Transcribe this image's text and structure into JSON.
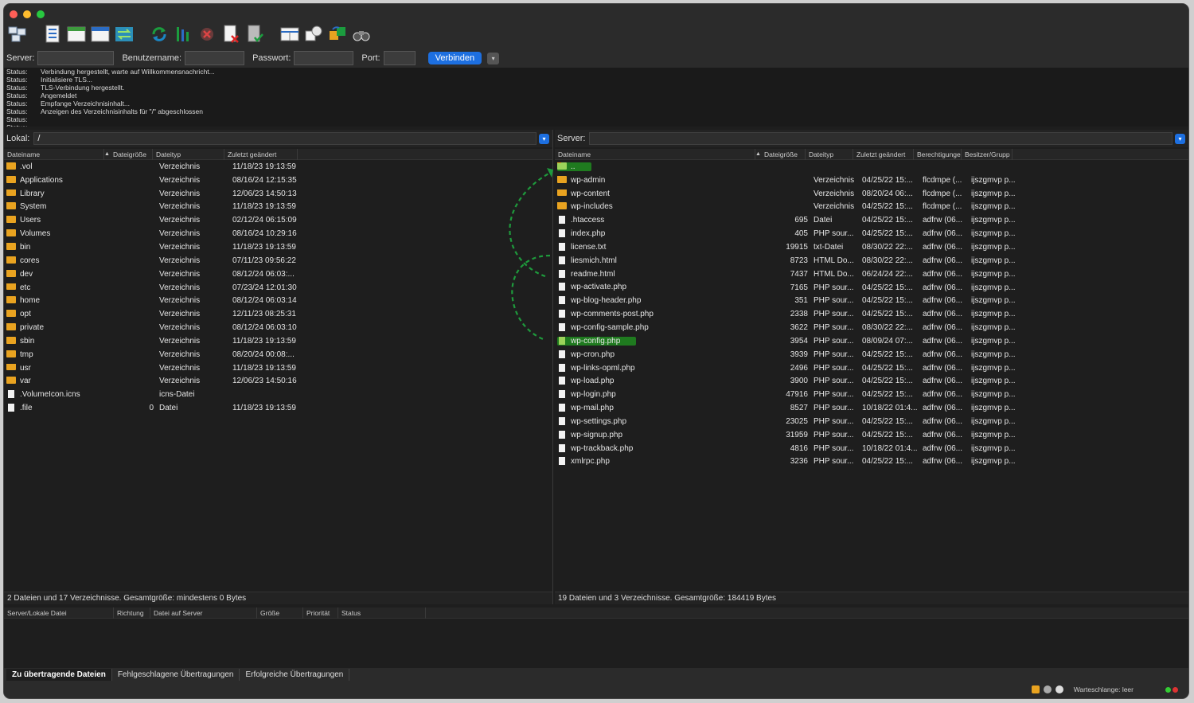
{
  "quickconnect": {
    "server_label": "Server:",
    "user_label": "Benutzername:",
    "password_label": "Passwort:",
    "port_label": "Port:",
    "connect_label": "Verbinden"
  },
  "log": [
    {
      "label": "Status:",
      "text": "Verbindung hergestellt, warte auf Willkommensnachricht..."
    },
    {
      "label": "Status:",
      "text": "Initialisiere TLS..."
    },
    {
      "label": "Status:",
      "text": "TLS-Verbindung hergestellt."
    },
    {
      "label": "Status:",
      "text": "Angemeldet"
    },
    {
      "label": "Status:",
      "text": "Empfange Verzeichnisinhalt..."
    },
    {
      "label": "Status:",
      "text": "Anzeigen des Verzeichnisinhalts für \"/\" abgeschlossen"
    },
    {
      "label": "Status:",
      "text": ""
    },
    {
      "label": "Status:",
      "text": ""
    }
  ],
  "local": {
    "path_label": "Lokal:",
    "path": "/",
    "columns": [
      "Dateiname",
      "Dateigröße",
      "Dateityp",
      "Zuletzt geändert"
    ],
    "rows": [
      {
        "name": ".vol",
        "kind": "folder",
        "size": "",
        "type": "Verzeichnis",
        "modified": "11/18/23 19:13:59"
      },
      {
        "name": "Applications",
        "kind": "folder",
        "size": "",
        "type": "Verzeichnis",
        "modified": "08/16/24 12:15:35"
      },
      {
        "name": "Library",
        "kind": "folder",
        "size": "",
        "type": "Verzeichnis",
        "modified": "12/06/23 14:50:13"
      },
      {
        "name": "System",
        "kind": "folder",
        "size": "",
        "type": "Verzeichnis",
        "modified": "11/18/23 19:13:59"
      },
      {
        "name": "Users",
        "kind": "folder",
        "size": "",
        "type": "Verzeichnis",
        "modified": "02/12/24 06:15:09"
      },
      {
        "name": "Volumes",
        "kind": "folder",
        "size": "",
        "type": "Verzeichnis",
        "modified": "08/16/24 10:29:16"
      },
      {
        "name": "bin",
        "kind": "folder",
        "size": "",
        "type": "Verzeichnis",
        "modified": "11/18/23 19:13:59"
      },
      {
        "name": "cores",
        "kind": "folder",
        "size": "",
        "type": "Verzeichnis",
        "modified": "07/11/23 09:56:22"
      },
      {
        "name": "dev",
        "kind": "folder",
        "size": "",
        "type": "Verzeichnis",
        "modified": "08/12/24 06:03:..."
      },
      {
        "name": "etc",
        "kind": "folder",
        "size": "",
        "type": "Verzeichnis",
        "modified": "07/23/24 12:01:30"
      },
      {
        "name": "home",
        "kind": "folder",
        "size": "",
        "type": "Verzeichnis",
        "modified": "08/12/24 06:03:14"
      },
      {
        "name": "opt",
        "kind": "folder",
        "size": "",
        "type": "Verzeichnis",
        "modified": "12/11/23 08:25:31"
      },
      {
        "name": "private",
        "kind": "folder",
        "size": "",
        "type": "Verzeichnis",
        "modified": "08/12/24 06:03:10"
      },
      {
        "name": "sbin",
        "kind": "folder",
        "size": "",
        "type": "Verzeichnis",
        "modified": "11/18/23 19:13:59"
      },
      {
        "name": "tmp",
        "kind": "folder",
        "size": "",
        "type": "Verzeichnis",
        "modified": "08/20/24 00:08:..."
      },
      {
        "name": "usr",
        "kind": "folder",
        "size": "",
        "type": "Verzeichnis",
        "modified": "11/18/23 19:13:59"
      },
      {
        "name": "var",
        "kind": "folder",
        "size": "",
        "type": "Verzeichnis",
        "modified": "12/06/23 14:50:16"
      },
      {
        "name": ".VolumeIcon.icns",
        "kind": "file",
        "size": "",
        "type": "icns-Datei",
        "modified": ""
      },
      {
        "name": ".file",
        "kind": "file",
        "size": "0",
        "type": "Datei",
        "modified": "11/18/23 19:13:59"
      }
    ],
    "status": "2 Dateien und 17 Verzeichnisse. Gesamtgröße: mindestens 0 Bytes"
  },
  "remote": {
    "path_label": "Server:",
    "path": "",
    "columns": [
      "Dateiname",
      "Dateigröße",
      "Dateityp",
      "Zuletzt geändert",
      "Berechtigunge",
      "Besitzer/Grupp"
    ],
    "rows": [
      {
        "name": "..",
        "kind": "folder",
        "size": "",
        "type": "",
        "modified": "",
        "perm": "",
        "owner": "",
        "highlight": true
      },
      {
        "name": "wp-admin",
        "kind": "folder",
        "size": "",
        "type": "Verzeichnis",
        "modified": "04/25/22 15:...",
        "perm": "flcdmpe (...",
        "owner": "ijszgmvp p..."
      },
      {
        "name": "wp-content",
        "kind": "folder",
        "size": "",
        "type": "Verzeichnis",
        "modified": "08/20/24 06:...",
        "perm": "flcdmpe (...",
        "owner": "ijszgmvp p..."
      },
      {
        "name": "wp-includes",
        "kind": "folder",
        "size": "",
        "type": "Verzeichnis",
        "modified": "04/25/22 15:...",
        "perm": "flcdmpe (...",
        "owner": "ijszgmvp p..."
      },
      {
        "name": ".htaccess",
        "kind": "file",
        "size": "695",
        "type": "Datei",
        "modified": "04/25/22 15:...",
        "perm": "adfrw (06...",
        "owner": "ijszgmvp p..."
      },
      {
        "name": "index.php",
        "kind": "file",
        "size": "405",
        "type": "PHP sour...",
        "modified": "04/25/22 15:...",
        "perm": "adfrw (06...",
        "owner": "ijszgmvp p..."
      },
      {
        "name": "license.txt",
        "kind": "file",
        "size": "19915",
        "type": "txt-Datei",
        "modified": "08/30/22 22:...",
        "perm": "adfrw (06...",
        "owner": "ijszgmvp p..."
      },
      {
        "name": "liesmich.html",
        "kind": "file",
        "size": "8723",
        "type": "HTML Do...",
        "modified": "08/30/22 22:...",
        "perm": "adfrw (06...",
        "owner": "ijszgmvp p..."
      },
      {
        "name": "readme.html",
        "kind": "file",
        "size": "7437",
        "type": "HTML Do...",
        "modified": "06/24/24 22:...",
        "perm": "adfrw (06...",
        "owner": "ijszgmvp p..."
      },
      {
        "name": "wp-activate.php",
        "kind": "file",
        "size": "7165",
        "type": "PHP sour...",
        "modified": "04/25/22 15:...",
        "perm": "adfrw (06...",
        "owner": "ijszgmvp p..."
      },
      {
        "name": "wp-blog-header.php",
        "kind": "file",
        "size": "351",
        "type": "PHP sour...",
        "modified": "04/25/22 15:...",
        "perm": "adfrw (06...",
        "owner": "ijszgmvp p..."
      },
      {
        "name": "wp-comments-post.php",
        "kind": "file",
        "size": "2338",
        "type": "PHP sour...",
        "modified": "04/25/22 15:...",
        "perm": "adfrw (06...",
        "owner": "ijszgmvp p..."
      },
      {
        "name": "wp-config-sample.php",
        "kind": "file",
        "size": "3622",
        "type": "PHP sour...",
        "modified": "08/30/22 22:...",
        "perm": "adfrw (06...",
        "owner": "ijszgmvp p..."
      },
      {
        "name": "wp-config.php",
        "kind": "file",
        "size": "3954",
        "type": "PHP sour...",
        "modified": "08/09/24 07:...",
        "perm": "adfrw (06...",
        "owner": "ijszgmvp p...",
        "highlight": true
      },
      {
        "name": "wp-cron.php",
        "kind": "file",
        "size": "3939",
        "type": "PHP sour...",
        "modified": "04/25/22 15:...",
        "perm": "adfrw (06...",
        "owner": "ijszgmvp p..."
      },
      {
        "name": "wp-links-opml.php",
        "kind": "file",
        "size": "2496",
        "type": "PHP sour...",
        "modified": "04/25/22 15:...",
        "perm": "adfrw (06...",
        "owner": "ijszgmvp p..."
      },
      {
        "name": "wp-load.php",
        "kind": "file",
        "size": "3900",
        "type": "PHP sour...",
        "modified": "04/25/22 15:...",
        "perm": "adfrw (06...",
        "owner": "ijszgmvp p..."
      },
      {
        "name": "wp-login.php",
        "kind": "file",
        "size": "47916",
        "type": "PHP sour...",
        "modified": "04/25/22 15:...",
        "perm": "adfrw (06...",
        "owner": "ijszgmvp p..."
      },
      {
        "name": "wp-mail.php",
        "kind": "file",
        "size": "8527",
        "type": "PHP sour...",
        "modified": "10/18/22 01:4...",
        "perm": "adfrw (06...",
        "owner": "ijszgmvp p..."
      },
      {
        "name": "wp-settings.php",
        "kind": "file",
        "size": "23025",
        "type": "PHP sour...",
        "modified": "04/25/22 15:...",
        "perm": "adfrw (06...",
        "owner": "ijszgmvp p..."
      },
      {
        "name": "wp-signup.php",
        "kind": "file",
        "size": "31959",
        "type": "PHP sour...",
        "modified": "04/25/22 15:...",
        "perm": "adfrw (06...",
        "owner": "ijszgmvp p..."
      },
      {
        "name": "wp-trackback.php",
        "kind": "file",
        "size": "4816",
        "type": "PHP sour...",
        "modified": "10/18/22 01:4...",
        "perm": "adfrw (06...",
        "owner": "ijszgmvp p..."
      },
      {
        "name": "xmlrpc.php",
        "kind": "file",
        "size": "3236",
        "type": "PHP sour...",
        "modified": "04/25/22 15:...",
        "perm": "adfrw (06...",
        "owner": "ijszgmvp p..."
      }
    ],
    "status": "19 Dateien und 3 Verzeichnisse. Gesamtgröße: 184419 Bytes"
  },
  "queue": {
    "columns": [
      "Server/Lokale Datei",
      "Richtung",
      "Datei auf Server",
      "Größe",
      "Priorität",
      "Status"
    ],
    "tabs": [
      "Zu übertragende Dateien",
      "Fehlgeschlagene Übertragungen",
      "Erfolgreiche Übertragungen"
    ],
    "queue_status": "Warteschlange: leer"
  },
  "colors": {
    "accent": "#1d6fe0",
    "highlight": "#1f7a1f",
    "folder": "#e9a320",
    "arrow": "#1e9a3c"
  }
}
